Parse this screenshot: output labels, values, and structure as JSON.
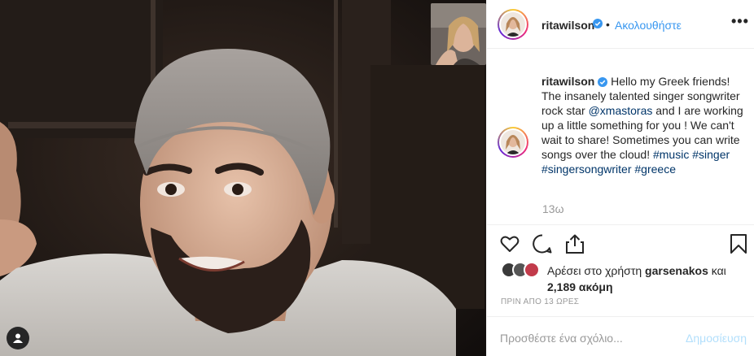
{
  "post": {
    "username": "ritawilson",
    "follow_label": "Ακολουθήστε",
    "separator": "•",
    "more_label": "•••",
    "caption": {
      "username": "ritawilson",
      "text_1": "Hello my Greek friends! The insanely talented singer songwriter rock star ",
      "mention": "@xmastoras",
      "text_2": " and I are working up a little something for you ! We can't wait to share! Sometimes you can write songs over the cloud! ",
      "tags": [
        "#music",
        "#singer",
        "#singersongwriter",
        "#greece"
      ]
    },
    "time_ago": "13ω",
    "likes": {
      "prefix": "Αρέσει στο χρήστη ",
      "user": "garsenakos",
      "middle": " και",
      "count": "2,189 ακόμη"
    },
    "posted": "ΠΡΙΝ ΑΠΟ 13 ΩΡΕΣ",
    "comment": {
      "placeholder": "Προσθέστε ένα σχόλιο...",
      "post_label": "Δημοσίευση"
    }
  },
  "icons": [
    "heart-icon",
    "comment-icon",
    "share-icon",
    "bookmark-icon",
    "verified-icon",
    "tagged-user-icon"
  ],
  "colors": {
    "link": "#003569",
    "follow": "#3897f0",
    "muted": "#999999",
    "post_disabled": "#b2dffc",
    "border": "#efefef"
  }
}
